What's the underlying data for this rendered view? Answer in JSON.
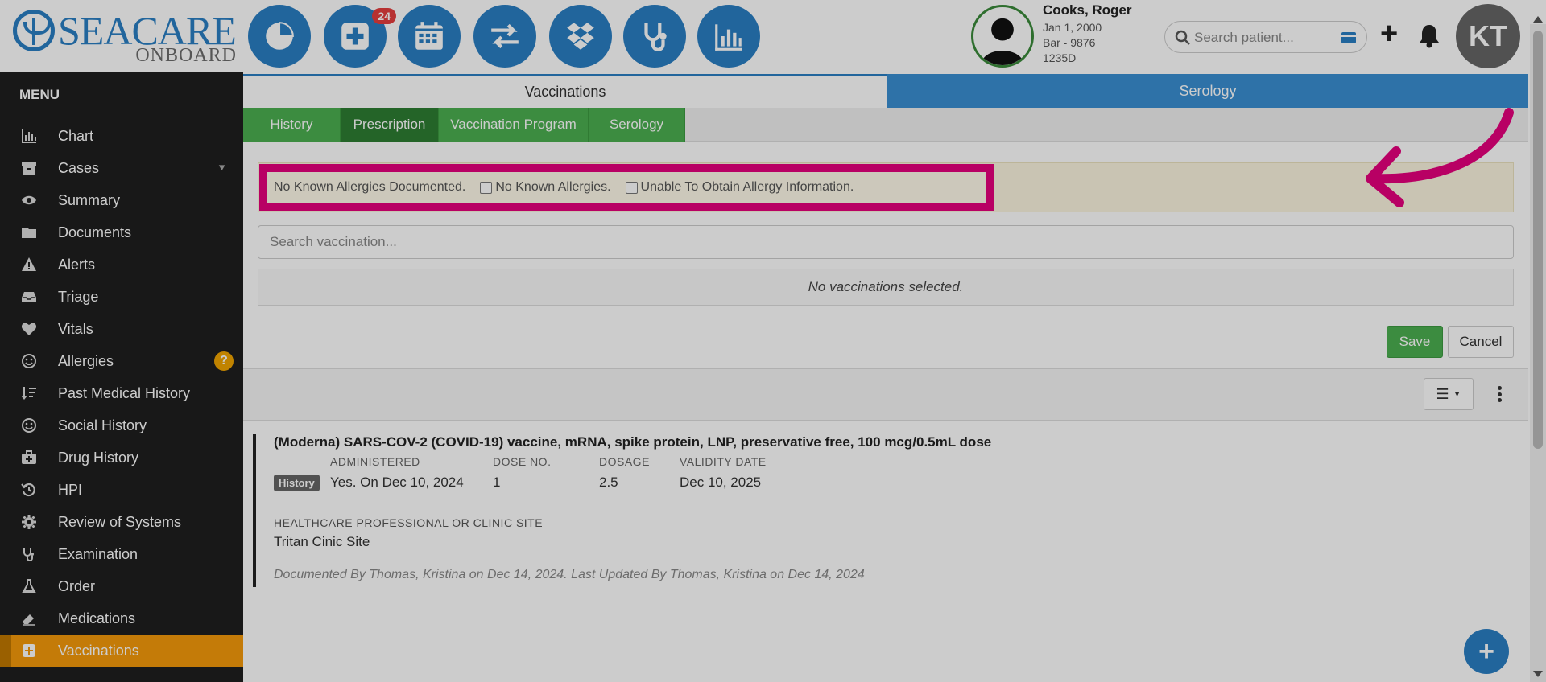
{
  "logo": {
    "brand": "SEACARE",
    "sub": "ONBOARD"
  },
  "nav": {
    "badge_count": "24",
    "icons": [
      "pie-chart-icon",
      "medical-plus-icon",
      "calendar-icon",
      "transfer-arrows-icon",
      "dropbox-icon",
      "stethoscope-icon",
      "bar-chart-icon"
    ]
  },
  "patient": {
    "name": "Cooks, Roger",
    "dob": "Jan 1, 2000",
    "id_line": "Bar - 9876",
    "code": "1235D"
  },
  "search": {
    "placeholder": "Search patient..."
  },
  "user": {
    "initials": "KT"
  },
  "sidebar": {
    "title": "MENU",
    "items": [
      {
        "label": "Chart",
        "icon": "bar-chart-icon"
      },
      {
        "label": "Cases",
        "icon": "archive-icon"
      },
      {
        "label": "Summary",
        "icon": "eye-icon"
      },
      {
        "label": "Documents",
        "icon": "folder-icon"
      },
      {
        "label": "Alerts",
        "icon": "warning-icon"
      },
      {
        "label": "Triage",
        "icon": "inbox-icon"
      },
      {
        "label": "Vitals",
        "icon": "heart-icon"
      },
      {
        "label": "Allergies",
        "icon": "smile-icon",
        "help": "?"
      },
      {
        "label": "Past Medical History",
        "icon": "sort-icon"
      },
      {
        "label": "Social History",
        "icon": "smile-icon"
      },
      {
        "label": "Drug History",
        "icon": "medkit-icon"
      },
      {
        "label": "HPI",
        "icon": "history-icon"
      },
      {
        "label": "Review of Systems",
        "icon": "gear-icon"
      },
      {
        "label": "Examination",
        "icon": "stethoscope-icon"
      },
      {
        "label": "Order",
        "icon": "flask-icon"
      },
      {
        "label": "Medications",
        "icon": "eraser-icon"
      },
      {
        "label": "Vaccinations",
        "icon": "plus-square-icon",
        "active": true
      }
    ]
  },
  "tabs": {
    "vaccinations": "Vaccinations",
    "serology": "Serology"
  },
  "subtabs": [
    "History",
    "Prescription",
    "Vaccination Program",
    "Serology"
  ],
  "allergy": {
    "documented": "No Known Allergies Documented.",
    "nka_label": "No Known Allergies.",
    "unable_label": "Unable To Obtain Allergy Information."
  },
  "vaccination_search": {
    "placeholder": "Search vaccination..."
  },
  "empty_message": "No vaccinations selected.",
  "buttons": {
    "save": "Save",
    "cancel": "Cancel"
  },
  "record": {
    "title": "(Moderna) SARS-COV-2 (COVID-19) vaccine, mRNA, spike protein, LNP, preservative free, 100 mcg/0.5mL dose",
    "badge": "History",
    "columns": [
      {
        "header": "ADMINISTERED",
        "value": "Yes. On Dec 10, 2024"
      },
      {
        "header": "DOSE NO.",
        "value": "1"
      },
      {
        "header": "DOSAGE",
        "value": "2.5"
      },
      {
        "header": "VALIDITY DATE",
        "value": "Dec 10, 2025"
      }
    ],
    "site_header": "HEALTHCARE PROFESSIONAL OR CLINIC SITE",
    "site_value": "Tritan Cinic Site",
    "doc_note": "Documented By Thomas, Kristina on Dec 14, 2024. Last Updated By Thomas, Kristina on Dec 14, 2024"
  },
  "colors": {
    "primary": "#2a7fc4",
    "green": "#4caf50",
    "active_orange": "#f59a0a",
    "highlight_pink": "#e6007e"
  }
}
